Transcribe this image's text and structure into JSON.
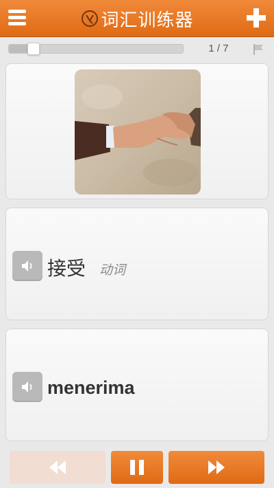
{
  "header": {
    "title": "词汇训练器",
    "menu_icon": "menu-icon",
    "add_icon": "plus-icon",
    "logo_icon": "logo-icon",
    "accent_color": "#e8761f"
  },
  "progress": {
    "counter": "1 / 7",
    "fraction": 0.14,
    "flag_icon": "flag-icon"
  },
  "card": {
    "image_description_icon": "handshake-image",
    "word": "接受",
    "part_of_speech": "动词",
    "translation": "menerima",
    "sound_icon": "speaker-icon"
  },
  "controls": {
    "prev_icon": "rewind-icon",
    "pause_icon": "pause-icon",
    "next_icon": "fast-forward-icon"
  }
}
